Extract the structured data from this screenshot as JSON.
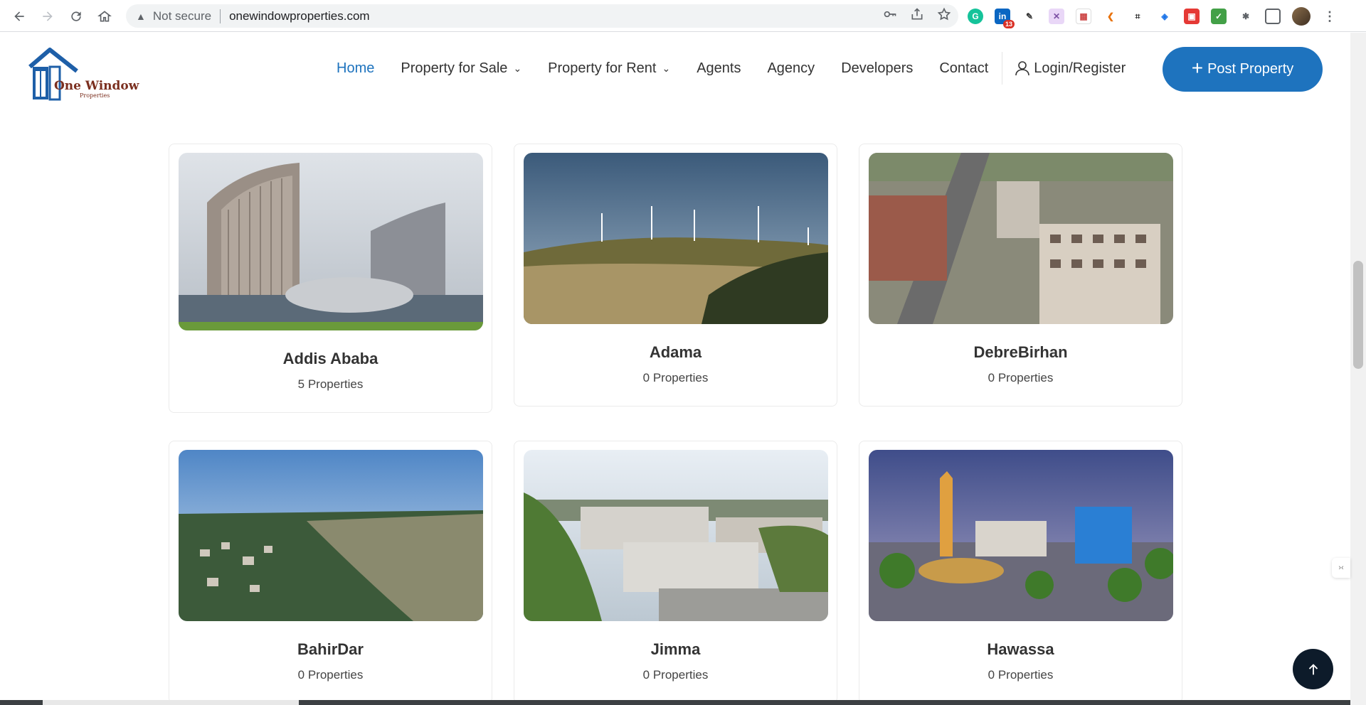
{
  "browser": {
    "not_secure": "Not secure",
    "url": "onewindowproperties.com",
    "ext_badge": "13"
  },
  "site": {
    "brand_name": "One Window",
    "brand_sub": "Properties",
    "nav": {
      "home": "Home",
      "sale": "Property for Sale",
      "rent": "Property for Rent",
      "agents": "Agents",
      "agency": "Agency",
      "developers": "Developers",
      "contact": "Contact",
      "login": "Login/Register"
    },
    "post_button": "Post Property",
    "accent_color": "#1e73be"
  },
  "cities": [
    {
      "name": "Addis Ababa",
      "count": "5 Properties",
      "image": "modern-curved-office-building"
    },
    {
      "name": "Adama",
      "count": "0 Properties",
      "image": "wind-turbines-on-hill"
    },
    {
      "name": "DebreBirhan",
      "count": "0 Properties",
      "image": "aerial-city-street"
    },
    {
      "name": "BahirDar",
      "count": "0 Properties",
      "image": "aerial-lakeside-city"
    },
    {
      "name": "Jimma",
      "count": "0 Properties",
      "image": "campus-buildings"
    },
    {
      "name": "Hawassa",
      "count": "0 Properties",
      "image": "city-square-monument"
    }
  ]
}
